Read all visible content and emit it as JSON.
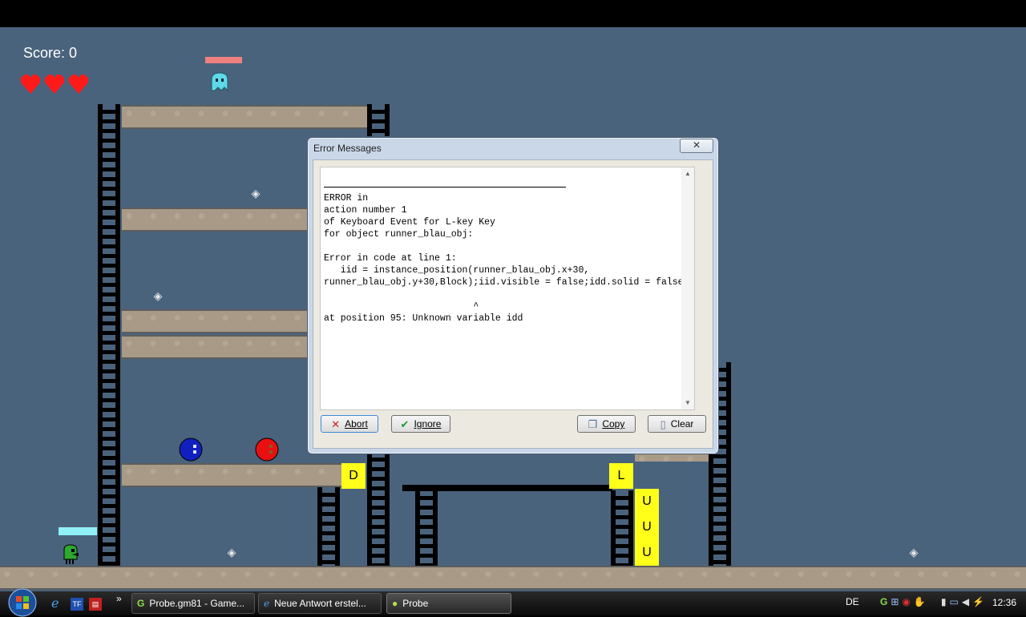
{
  "game": {
    "score_text": "Score: 0",
    "lives": 3,
    "colors": {
      "background": "#4a637d",
      "heart": "#ff1a1a",
      "block_letter_bg": "#ffff1a"
    },
    "letter_blocks": [
      "D",
      "L",
      "U",
      "U",
      "U"
    ],
    "icons": [
      "heart-icon",
      "ghost-icon",
      "diamond-icon",
      "blue-ball-icon",
      "red-ball-icon",
      "green-runner-icon"
    ]
  },
  "dialog": {
    "title": "Error Messages",
    "close_label": "✕",
    "message": "ERROR in\naction number 1\nof Keyboard Event for L-key Key\nfor object runner_blau_obj:\n\nError in code at line 1:\n   iid = instance_position(runner_blau_obj.x+30,\nrunner_blau_obj.y+30,Block);iid.visible = false;idd.solid = false\n\n                           ^\nat position 95: Unknown variable idd",
    "buttons": {
      "abort": "Abort",
      "ignore": "Ignore",
      "copy": "Copy",
      "clear": "Clear"
    }
  },
  "taskbar": {
    "tasks": [
      {
        "label": "Probe.gm81 - Game...",
        "icon": "gamemaker-icon"
      },
      {
        "label": "Neue Antwort erstel...",
        "icon": "ie-icon"
      },
      {
        "label": "Probe",
        "icon": "app-icon"
      }
    ],
    "language": "DE",
    "clock": "12:36",
    "overflow": "»"
  }
}
